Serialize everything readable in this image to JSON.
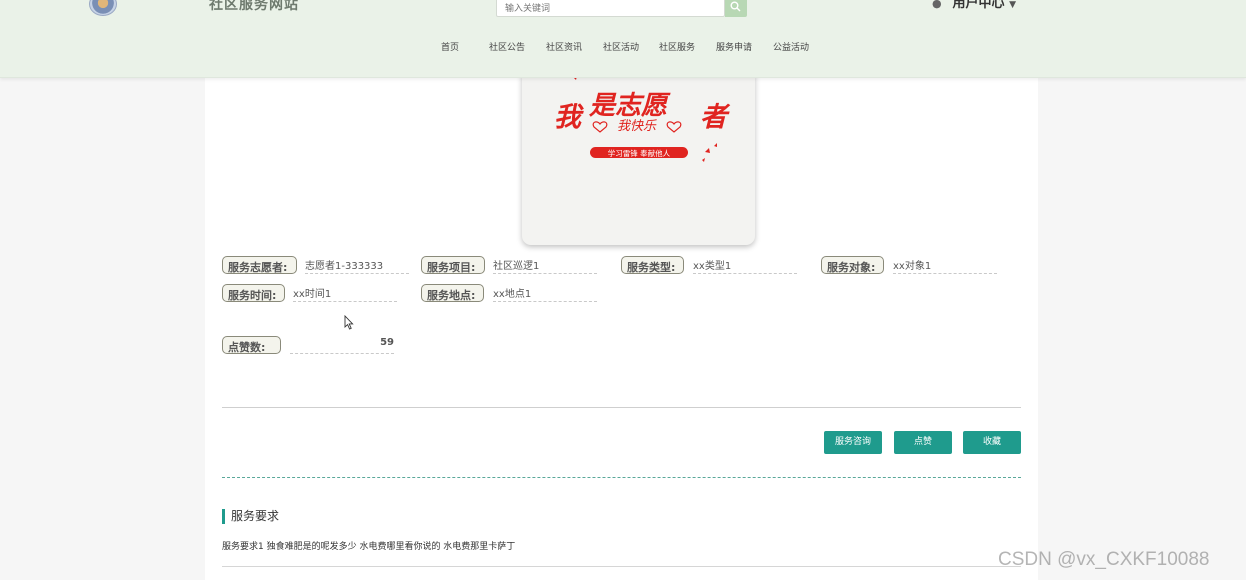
{
  "header": {
    "site_title": "社区服务网站",
    "search_placeholder": "输入关键词",
    "user_label": "用户中心",
    "user_icon": "user-icon"
  },
  "nav": {
    "items": [
      "首页",
      "社区公告",
      "社区资讯",
      "社区活动",
      "社区服务",
      "服务申请",
      "公益活动"
    ]
  },
  "poster": {
    "headline_1": "我",
    "headline_2": "是志愿",
    "headline_3": "者",
    "subline": "我快乐",
    "banner": "学习雷锋 奉献他人",
    "accent_color": "#e02420"
  },
  "details": {
    "volunteer_label": "服务志愿者:",
    "volunteer_value": "志愿者1-333333",
    "project_label": "服务项目:",
    "project_value": "社区巡逻1",
    "type_label": "服务类型:",
    "type_value": "xx类型1",
    "target_label": "服务对象:",
    "target_value": "xx对象1",
    "time_label": "服务时间:",
    "time_value": "xx时间1",
    "place_label": "服务地点:",
    "place_value": "xx地点1",
    "likes_label": "点赞数:",
    "likes_value": "59"
  },
  "actions": {
    "consult_label": "服务咨询",
    "like_label": "点赞",
    "favorite_label": "收藏",
    "button_color": "#1f9b8d"
  },
  "requirements": {
    "title": "服务要求",
    "text": "服务要求1 独食难肥是的呢发多少 水电费哪里看你说的 水电费那里卡萨丁"
  },
  "watermark": "CSDN @vx_CXKF10088"
}
